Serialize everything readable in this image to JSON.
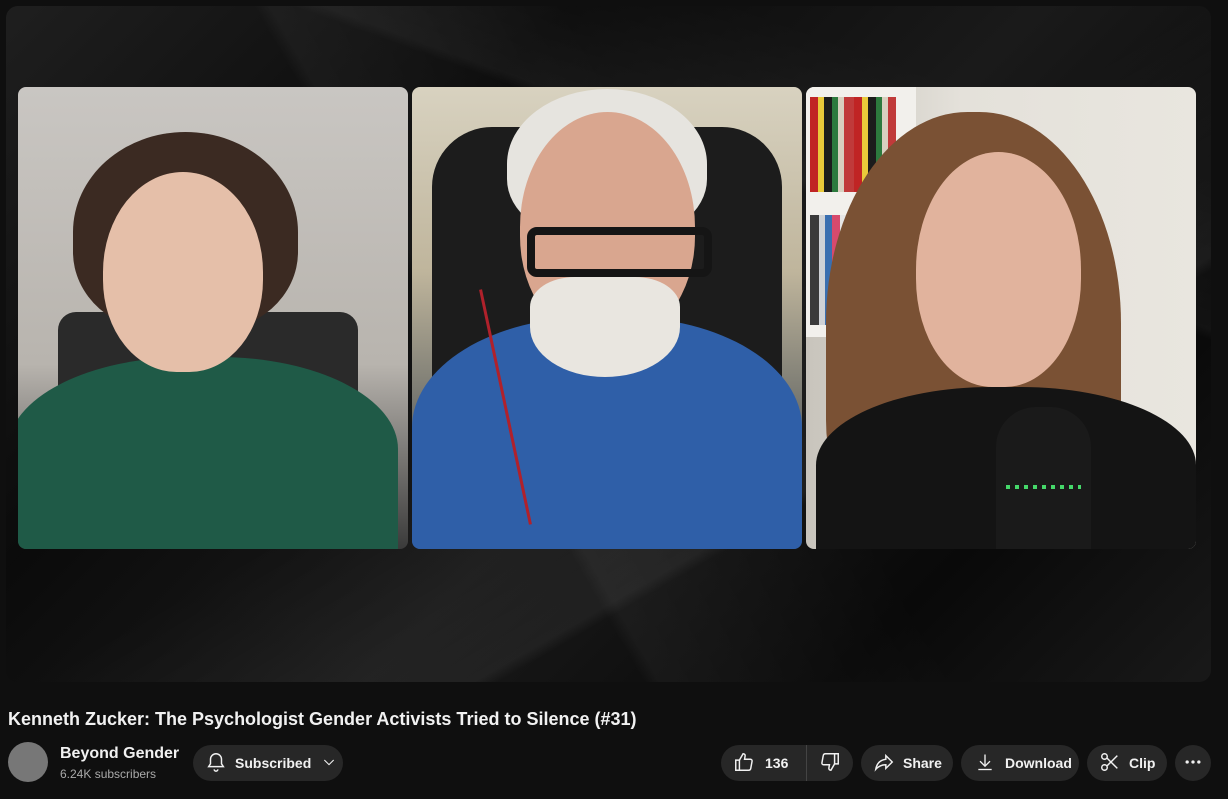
{
  "video": {
    "title": "Kenneth Zucker: The Psychologist Gender Activists Tried to Silence (#31)"
  },
  "channel": {
    "name": "Beyond Gender",
    "subscribers": "6.24K subscribers"
  },
  "actions": {
    "subscribed_label": "Subscribed",
    "like_count": "136",
    "share_label": "Share",
    "download_label": "Download",
    "clip_label": "Clip"
  },
  "icons": {
    "subscribed": "bell-icon",
    "subscribed_menu": "chevron-down-icon",
    "like": "thumbs-up-icon",
    "dislike": "thumbs-down-icon",
    "share": "share-arrow-icon",
    "download": "download-icon",
    "clip": "scissors-icon",
    "more": "more-horizontal-icon"
  },
  "colors": {
    "page_background": "#0f0f0f",
    "button_background": "#272727",
    "text_primary": "#f1f1f1",
    "text_secondary": "#aaaaaa"
  }
}
